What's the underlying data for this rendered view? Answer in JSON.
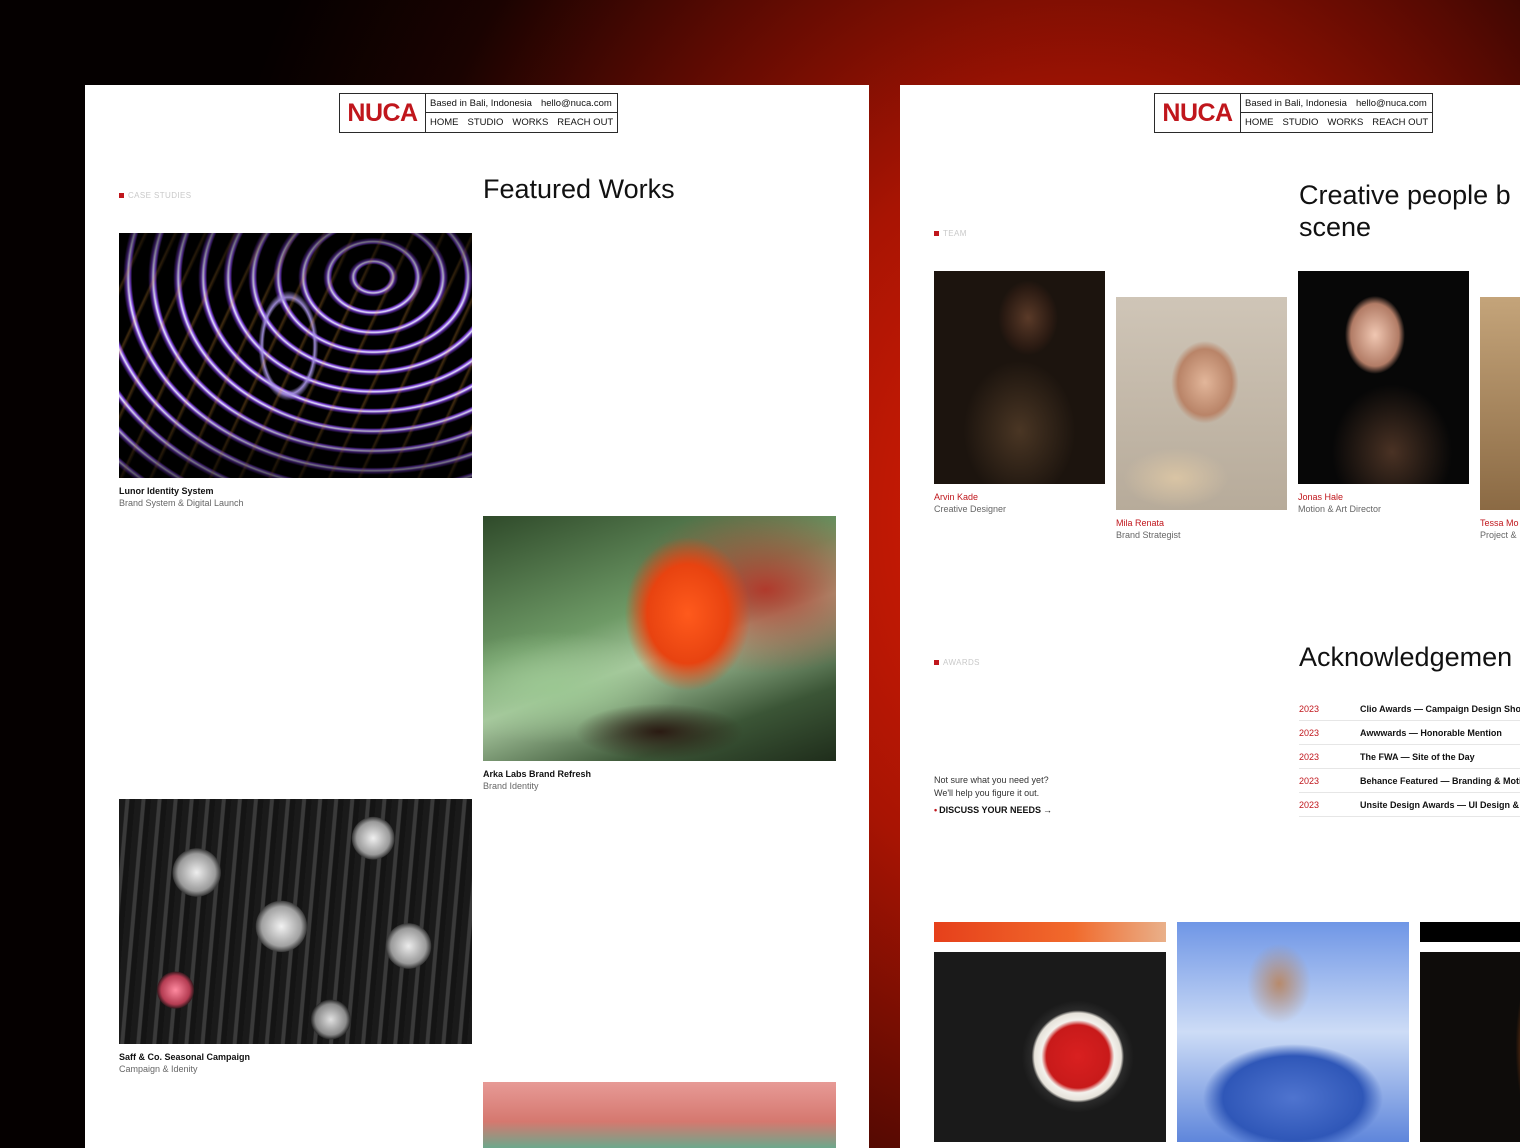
{
  "brand": {
    "logo": "NUCA",
    "location": "Based in Bali, Indonesia",
    "email": "hello@nuca.com",
    "accent": "#c0161c"
  },
  "nav": [
    "HOME",
    "STUDIO",
    "WORKS",
    "REACH OUT"
  ],
  "left": {
    "tag": "CASE STUDIES",
    "title": "Featured Works",
    "works": [
      {
        "title": "Lunor Identity System",
        "subtitle": "Brand System & Digital Launch"
      },
      {
        "title": "Arka Labs Brand Refresh",
        "subtitle": "Brand Identity"
      },
      {
        "title": "Saff & Co. Seasonal Campaign",
        "subtitle": "Campaign & Idenity"
      }
    ]
  },
  "right": {
    "team_tag": "TEAM",
    "team_title_line1": "Creative people b",
    "team_title_line2": "scene",
    "members": [
      {
        "name": "Arvin Kade",
        "role": "Creative Designer"
      },
      {
        "name": "Mila Renata",
        "role": "Brand Strategist"
      },
      {
        "name": "Jonas Hale",
        "role": "Motion & Art Director"
      },
      {
        "name": "Tessa Mo",
        "role": "Project &"
      }
    ],
    "awards_tag": "AWARDS",
    "awards_title": "Acknowledgemen",
    "awards": [
      {
        "year": "2023",
        "title": "Clio Awards — Campaign Design Shor"
      },
      {
        "year": "2023",
        "title": "Awwwards — Honorable Mention"
      },
      {
        "year": "2023",
        "title": "The FWA — Site of the Day"
      },
      {
        "year": "2023",
        "title": "Behance Featured — Branding & Motic"
      },
      {
        "year": "2023",
        "title": "Unsite Design Awards — UI Design & I"
      }
    ],
    "cta": {
      "line1": "Not sure what you need yet?",
      "line2": "We'll help you figure it out.",
      "link": "DISCUSS YOUR NEEDS",
      "arrow": "→",
      "bullet": "•"
    }
  }
}
